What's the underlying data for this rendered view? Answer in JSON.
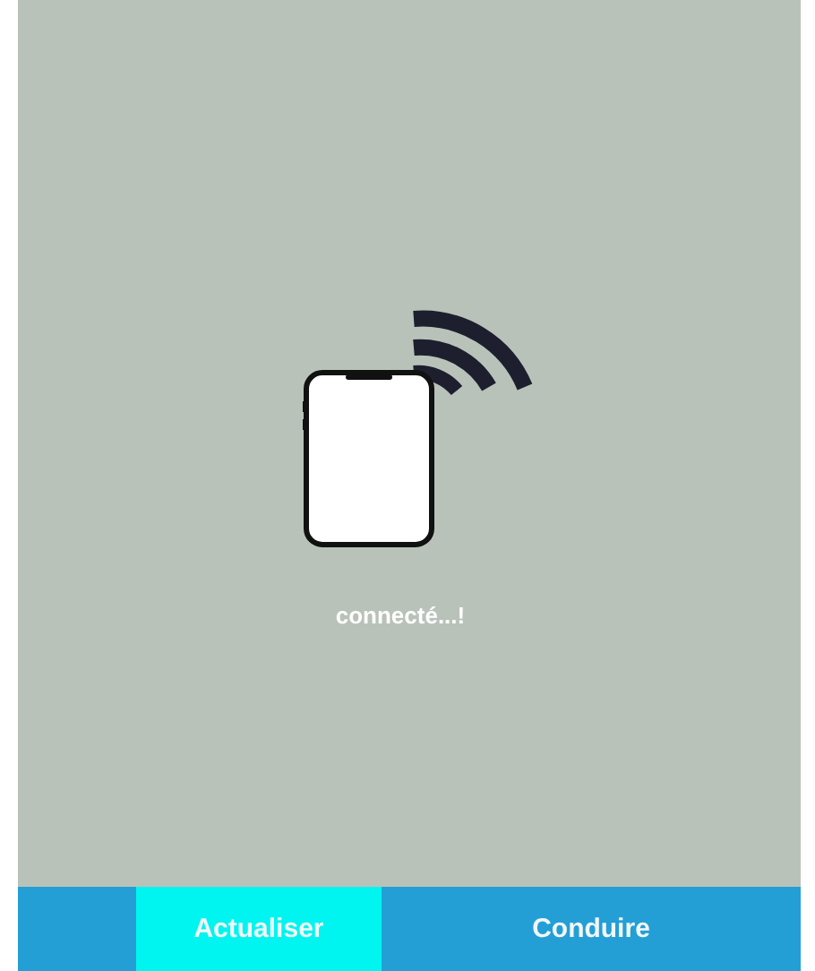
{
  "status": {
    "message": "connecté...!"
  },
  "bottom_bar": {
    "buttons": [
      {
        "label": "Actualiser",
        "selected": true
      },
      {
        "label": "Conduire",
        "selected": false
      }
    ]
  }
}
